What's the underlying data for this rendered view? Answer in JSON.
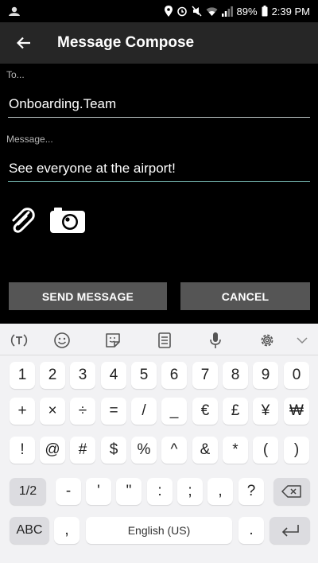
{
  "status_bar": {
    "battery": "89%",
    "time": "2:39 PM"
  },
  "app_bar": {
    "title": "Message Compose"
  },
  "form": {
    "to_label": "To...",
    "to_value": "Onboarding.Team",
    "message_label": "Message...",
    "message_value": "See everyone at the airport!"
  },
  "buttons": {
    "send": "SEND MESSAGE",
    "cancel": "CANCEL"
  },
  "keyboard": {
    "row1": [
      "1",
      "2",
      "3",
      "4",
      "5",
      "6",
      "7",
      "8",
      "9",
      "0"
    ],
    "row2": [
      "+",
      "×",
      "÷",
      "=",
      "/",
      "_",
      "€",
      "£",
      "¥",
      "₩"
    ],
    "row3": [
      "!",
      "@",
      "#",
      "$",
      "%",
      "^",
      "&",
      "*",
      "(",
      ")"
    ],
    "row4": [
      "1/2",
      "-",
      "'",
      "\"",
      ":",
      ";",
      ",",
      "?",
      "backspace-icon"
    ],
    "row5": [
      "ABC",
      ",",
      "English (US)",
      ".",
      "enter-icon"
    ]
  }
}
